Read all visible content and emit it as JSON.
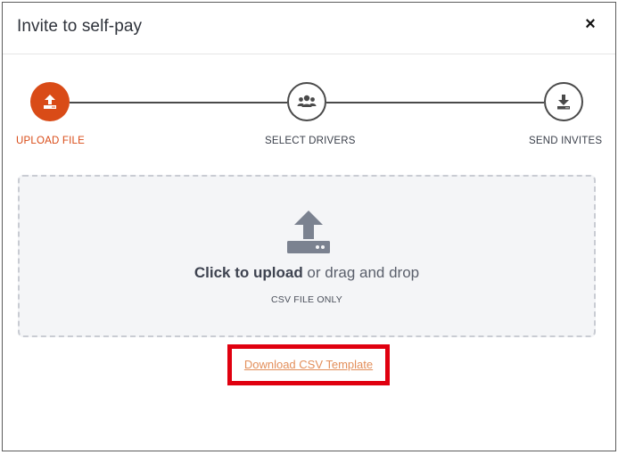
{
  "modal": {
    "title": "Invite to self-pay",
    "close_label": "×"
  },
  "stepper": {
    "steps": [
      {
        "label": "UPLOAD FILE",
        "icon": "upload-icon",
        "state": "active"
      },
      {
        "label": "SELECT DRIVERS",
        "icon": "users-icon",
        "state": "inactive"
      },
      {
        "label": "SEND INVITES",
        "icon": "download-icon",
        "state": "inactive"
      }
    ]
  },
  "dropzone": {
    "primary_bold": "Click to upload",
    "primary_rest": " or drag and drop",
    "sub": "CSV FILE ONLY",
    "icon": "upload-tray-icon"
  },
  "download": {
    "label": "Download CSV Template"
  },
  "colors": {
    "accent": "#d94b17",
    "link": "#e38f5b",
    "highlight_box": "#e0000f",
    "dropzone_bg": "#f4f5f7"
  }
}
